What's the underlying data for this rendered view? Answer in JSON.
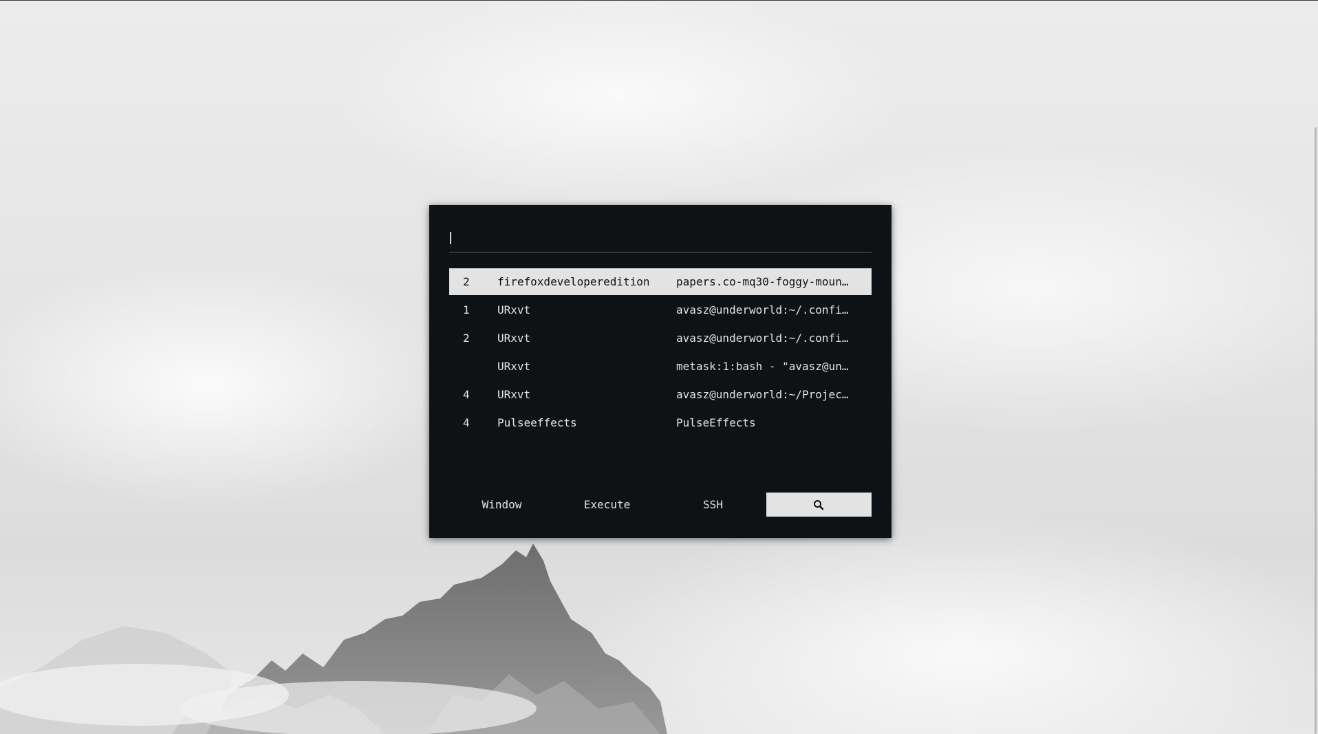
{
  "launcher": {
    "search": {
      "value": "",
      "placeholder": ""
    },
    "windows": [
      {
        "workspace": "2",
        "class": "firefoxdeveloperedition",
        "title": "papers.co-mq30-foggy-moun…",
        "selected": true
      },
      {
        "workspace": "1",
        "class": "URxvt",
        "title": "avasz@underworld:~/.confi…",
        "selected": false
      },
      {
        "workspace": "2",
        "class": "URxvt",
        "title": "avasz@underworld:~/.confi…",
        "selected": false
      },
      {
        "workspace": "",
        "class": "URxvt",
        "title": "metask:1:bash - \"avasz@un…",
        "selected": false
      },
      {
        "workspace": "4",
        "class": "URxvt",
        "title": "avasz@underworld:~/Projec…",
        "selected": false
      },
      {
        "workspace": "4",
        "class": "Pulseeffects",
        "title": "PulseEffects",
        "selected": false
      }
    ],
    "modes": [
      {
        "label": "Window"
      },
      {
        "label": "Execute"
      },
      {
        "label": "SSH"
      },
      {
        "icon": "search-icon",
        "active": true
      }
    ]
  },
  "colors": {
    "panel_bg": "#0f1214",
    "text": "#e3e3e3",
    "selected_bg": "#e3e3e3",
    "selected_text": "#111111"
  }
}
